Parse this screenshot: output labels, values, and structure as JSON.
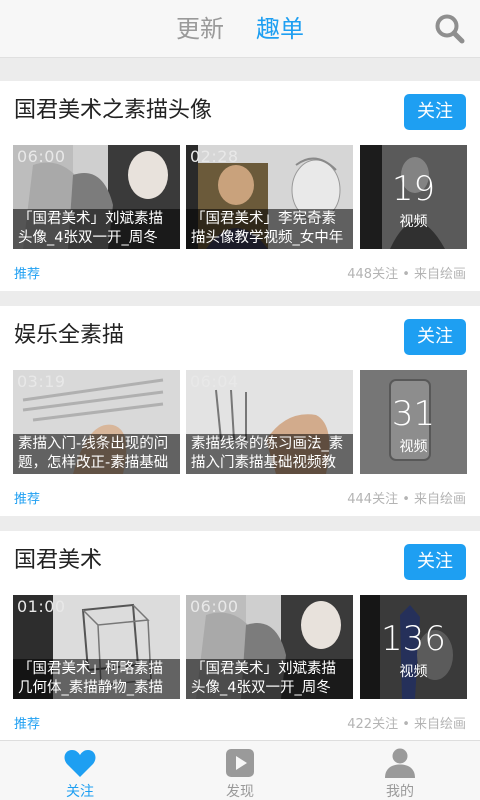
{
  "header": {
    "tab_update": "更新",
    "tab_qudan": "趣单",
    "search_icon": "search-icon"
  },
  "cards": [
    {
      "title": "国君美术之素描头像",
      "follow": "关注",
      "videos": [
        {
          "duration": "06:00",
          "caption1": "「国君美术」刘斌素描",
          "caption2": "头像_4张双一开_周冬"
        },
        {
          "duration": "02:28",
          "caption1": "「国君美术」李宪奇素",
          "caption2": "描头像教学视频_女中年"
        }
      ],
      "count": "19",
      "count_label": "视频",
      "recommend": "推荐",
      "meta": "448关注 • 来自绘画"
    },
    {
      "title": "娱乐全素描",
      "follow": "关注",
      "videos": [
        {
          "duration": "03:19",
          "caption1": "素描入门-线条出现的问",
          "caption2": "题，怎样改正-素描基础"
        },
        {
          "duration": "06:04",
          "caption1": "素描线条的练习画法_素",
          "caption2": "描入门素描基础视频教"
        }
      ],
      "count": "31",
      "count_label": "视频",
      "recommend": "推荐",
      "meta": "444关注 • 来自绘画"
    },
    {
      "title": "国君美术",
      "follow": "关注",
      "videos": [
        {
          "duration": "01:00",
          "caption1": "「国君美术」柯略素描",
          "caption2": "几何体_素描静物_素描"
        },
        {
          "duration": "06:00",
          "caption1": "「国君美术」刘斌素描",
          "caption2": "头像_4张双一开_周冬"
        }
      ],
      "count": "136",
      "count_label": "视频",
      "recommend": "推荐",
      "meta": "422关注 • 来自绘画"
    }
  ],
  "bottom_nav": {
    "follow": "关注",
    "discover": "发现",
    "mine": "我的"
  },
  "colors": {
    "accent": "#1e9ff2",
    "inactive": "#9a9a9a",
    "meta": "#b4b4b4"
  }
}
